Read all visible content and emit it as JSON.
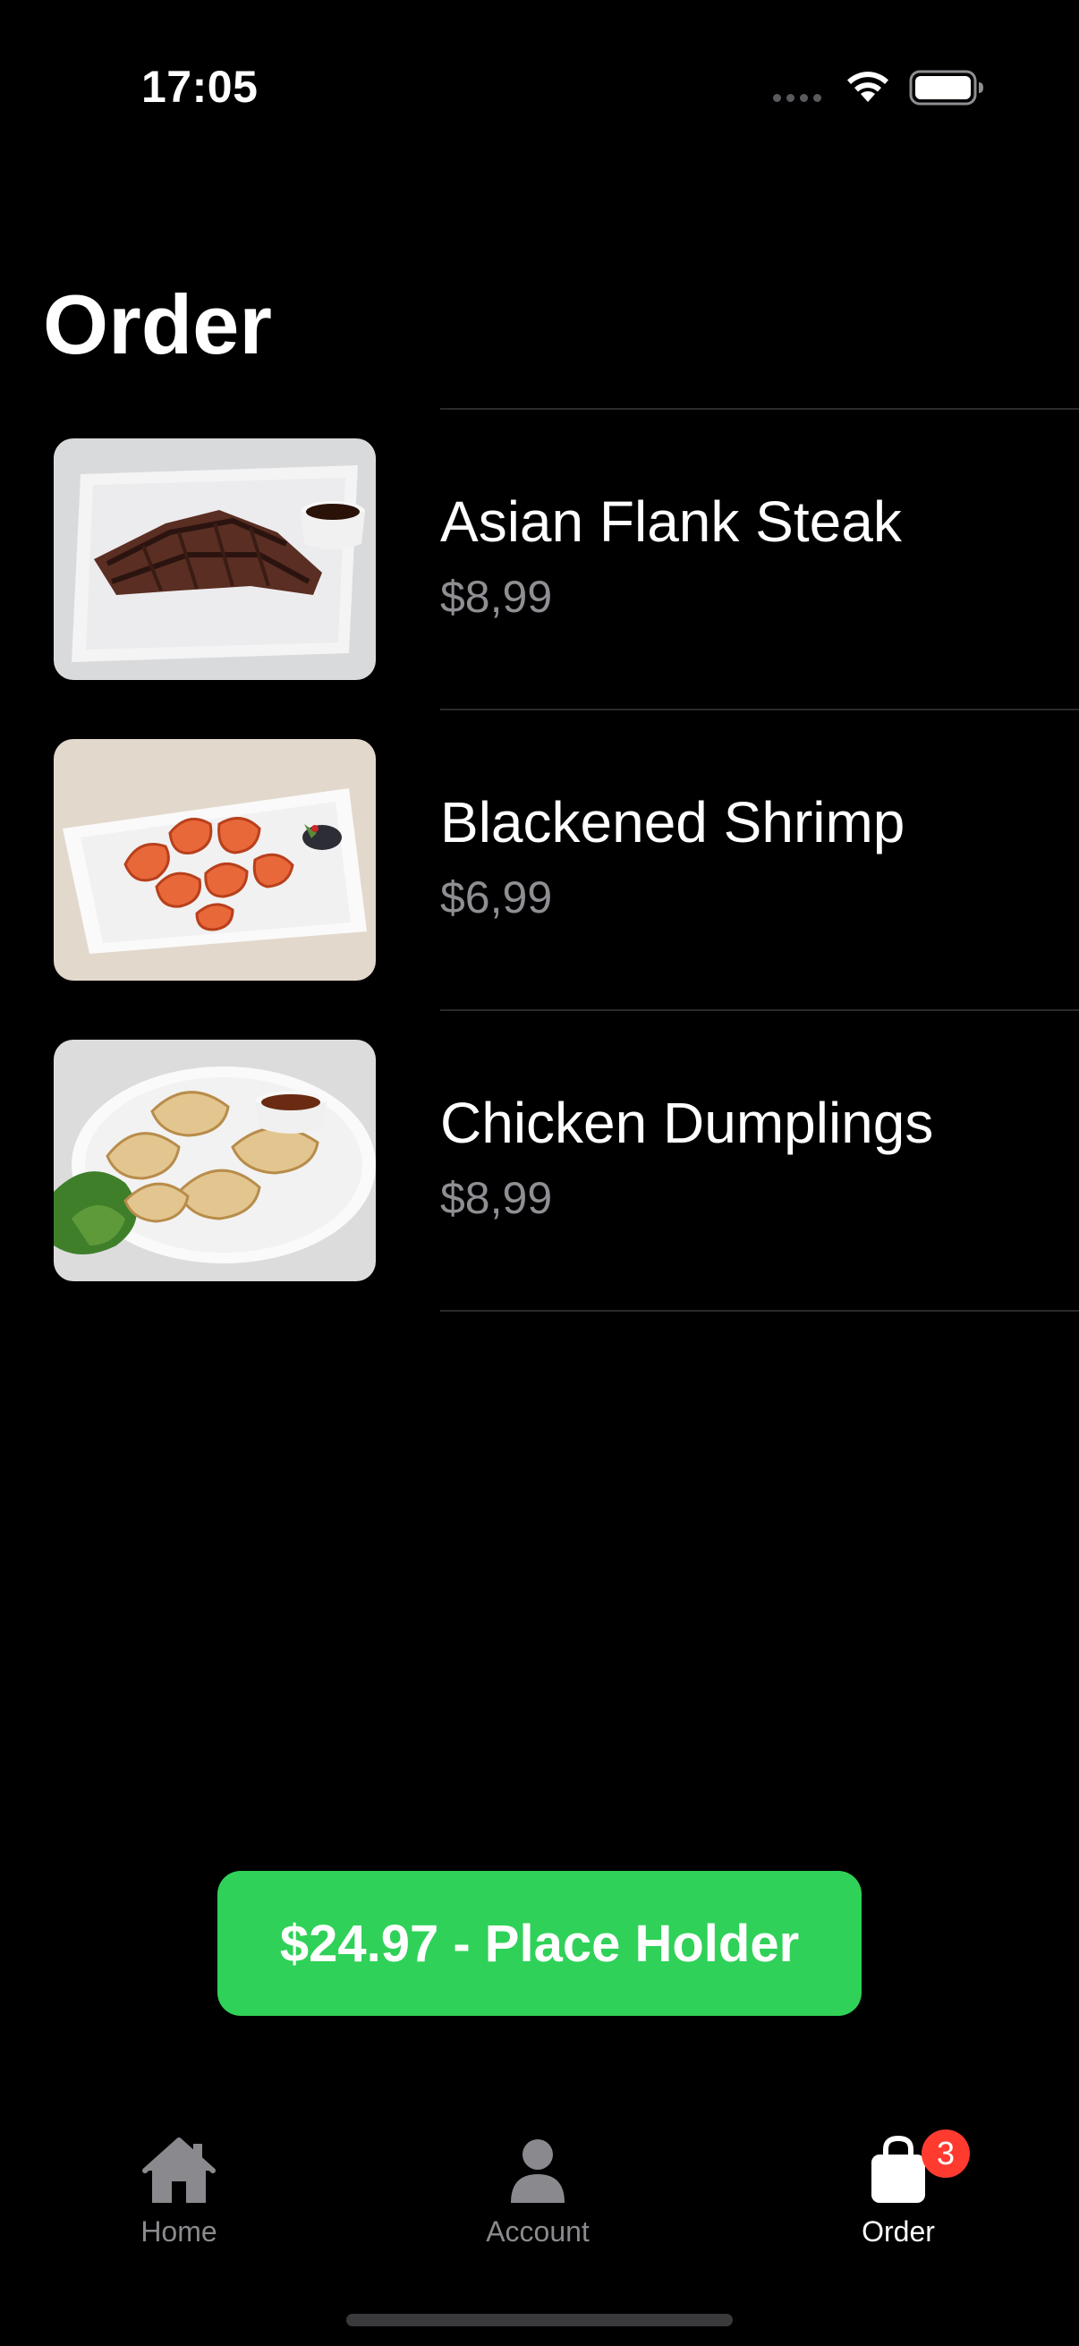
{
  "status_bar": {
    "time": "17:05"
  },
  "page": {
    "title": "Order"
  },
  "order_items": [
    {
      "name": "Asian Flank Steak",
      "price": "$8,99",
      "image": "flank-steak-photo"
    },
    {
      "name": "Blackened Shrimp",
      "price": "$6,99",
      "image": "shrimp-photo"
    },
    {
      "name": "Chicken Dumplings",
      "price": "$8,99",
      "image": "dumplings-photo"
    }
  ],
  "cta": {
    "label": "$24.97 - Place Holder",
    "color": "#30d158"
  },
  "tab_bar": {
    "tabs": [
      {
        "label": "Home",
        "icon": "house-icon",
        "active": false
      },
      {
        "label": "Account",
        "icon": "person-icon",
        "active": false
      },
      {
        "label": "Order",
        "icon": "bag-icon",
        "active": true
      }
    ],
    "order_badge": "3",
    "badge_color": "#ff3b30"
  }
}
